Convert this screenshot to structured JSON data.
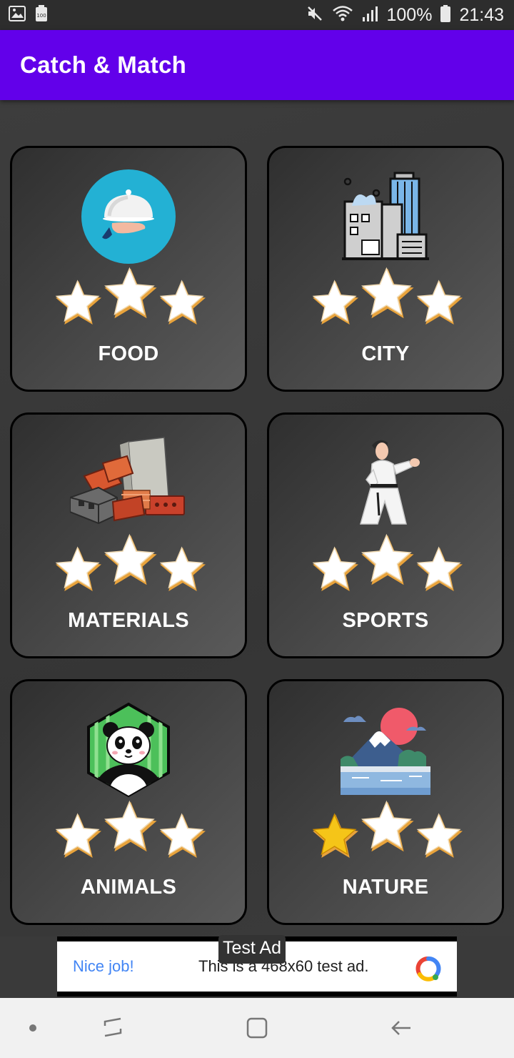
{
  "status_bar": {
    "battery_percent": "100%",
    "time": "21:43",
    "icons": [
      "image-icon",
      "battery-saver-icon",
      "mute-icon",
      "wifi-icon",
      "signal-icon",
      "battery-icon"
    ]
  },
  "app_bar": {
    "title": "Catch & Match"
  },
  "categories": [
    {
      "label": "FOOD",
      "icon": "food-cloche-icon",
      "stars_earned": 0,
      "stars_total": 3
    },
    {
      "label": "CITY",
      "icon": "city-buildings-icon",
      "stars_earned": 0,
      "stars_total": 3
    },
    {
      "label": "MATERIALS",
      "icon": "bricks-materials-icon",
      "stars_earned": 0,
      "stars_total": 3
    },
    {
      "label": "SPORTS",
      "icon": "karate-sports-icon",
      "stars_earned": 0,
      "stars_total": 3
    },
    {
      "label": "ANIMALS",
      "icon": "panda-icon",
      "stars_earned": 0,
      "stars_total": 3
    },
    {
      "label": "NATURE",
      "icon": "mountain-nature-icon",
      "stars_earned": 1,
      "stars_total": 3
    }
  ],
  "ad": {
    "tag": "Test Ad",
    "headline": "Nice job!",
    "description": "This is a 468x60 test ad."
  },
  "colors": {
    "app_bar": "#6200ea",
    "background": "#3a3a3a",
    "star_earned": "#f5c518",
    "star_empty": "#ffffff",
    "star_rim": "#e8a33c"
  }
}
